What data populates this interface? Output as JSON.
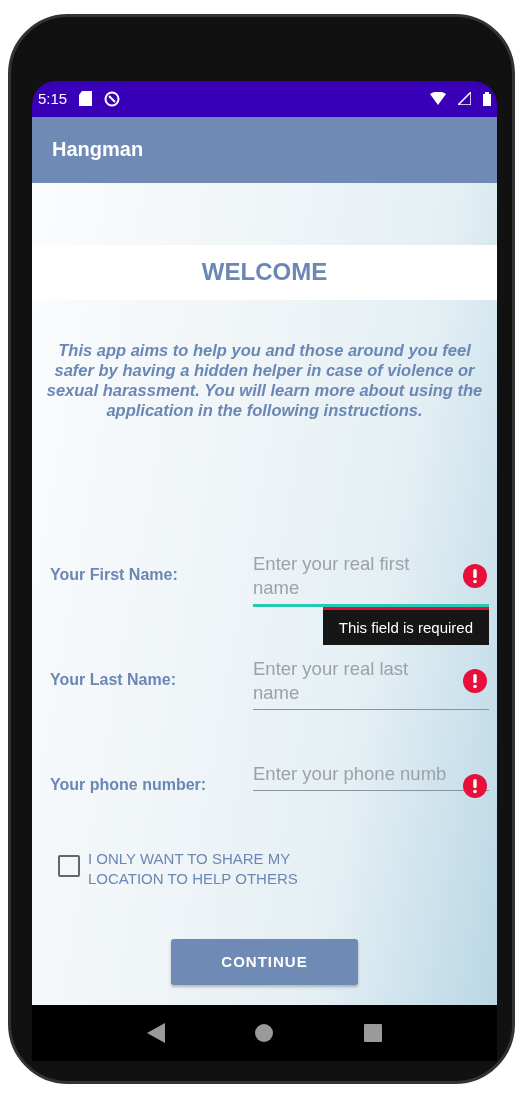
{
  "status_bar": {
    "time": "5:15"
  },
  "app_bar": {
    "title": "Hangman"
  },
  "heading": "WELCOME",
  "intro": "This app aims to help you and those around you feel safer by having a hidden helper in case of violence or sexual harassment. You will learn more about using the application in the following instructions.",
  "fields": [
    {
      "label": "Your First Name:",
      "placeholder": "Enter your real first name",
      "focused": true,
      "error": true,
      "error_message": "This field is required"
    },
    {
      "label": "Your Last Name:",
      "placeholder": "Enter your real last name",
      "focused": false,
      "error": true
    },
    {
      "label": "Your phone number:",
      "placeholder": "Enter your phone numb",
      "focused": false,
      "error": true
    }
  ],
  "checkbox": {
    "label": "I ONLY WANT TO SHARE MY LOCATION TO HELP OTHERS",
    "checked": false
  },
  "button": "CONTINUE"
}
